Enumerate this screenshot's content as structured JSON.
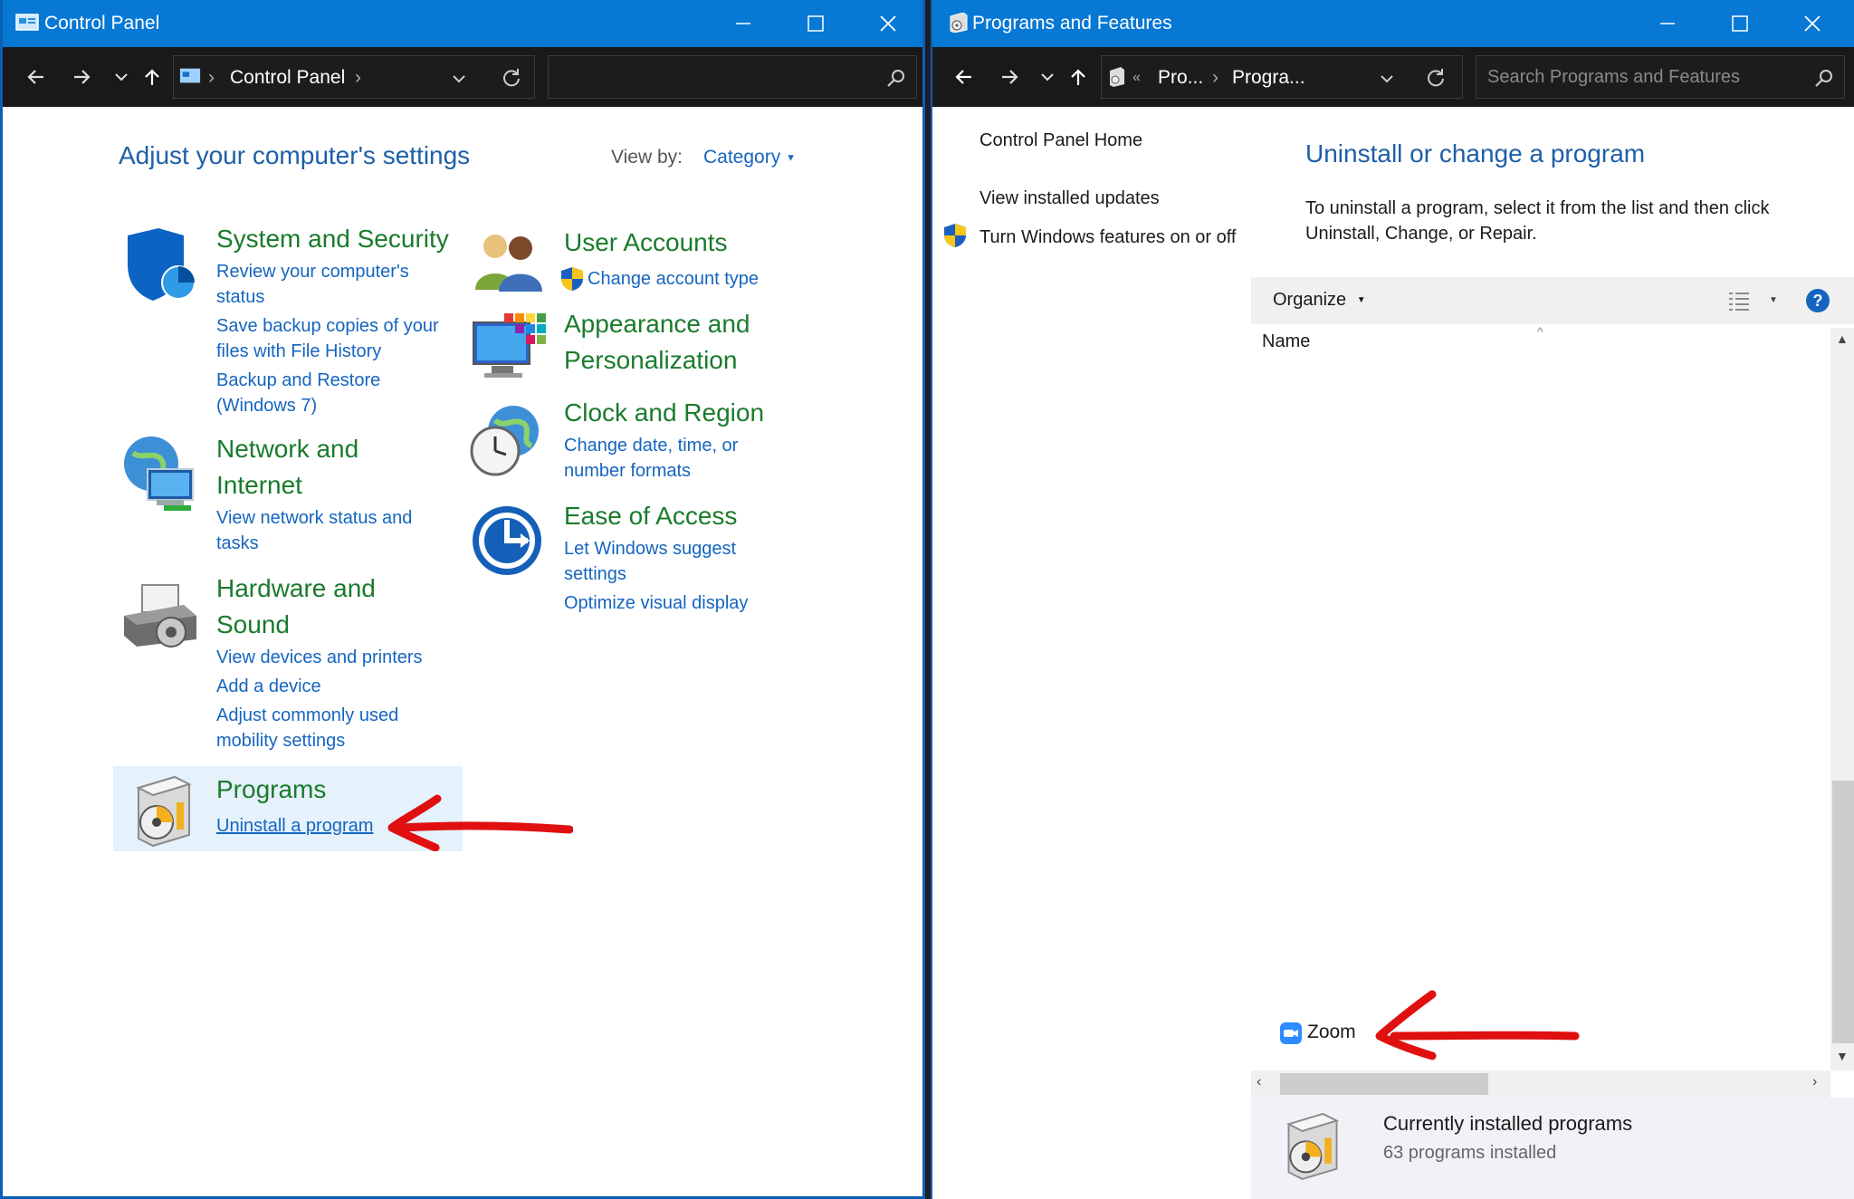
{
  "left_window": {
    "title": "Control Panel",
    "breadcrumb": "Control Panel",
    "heading": "Adjust your computer's settings",
    "view_by_label": "View by:",
    "view_by_value": "Category",
    "categories": [
      {
        "title": "System and Security",
        "links": [
          "Review your computer's status",
          "Save backup copies of your files with File History",
          "Backup and Restore (Windows 7)"
        ]
      },
      {
        "title": "Network and Internet",
        "links": [
          "View network status and tasks"
        ]
      },
      {
        "title": "Hardware and Sound",
        "links": [
          "View devices and printers",
          "Add a device",
          "Adjust commonly used mobility settings"
        ]
      },
      {
        "title": "Programs",
        "links": [
          "Uninstall a program"
        ]
      },
      {
        "title": "User Accounts",
        "links": [
          "Change account type"
        ]
      },
      {
        "title": "Appearance and Personalization",
        "links": []
      },
      {
        "title": "Clock and Region",
        "links": [
          "Change date, time, or number formats"
        ]
      },
      {
        "title": "Ease of Access",
        "links": [
          "Let Windows suggest settings",
          "Optimize visual display"
        ]
      }
    ]
  },
  "right_window": {
    "title": "Programs and Features",
    "breadcrumb": [
      "Pro...",
      "Progra..."
    ],
    "search_placeholder": "Search Programs and Features",
    "sidebar": {
      "home": "Control Panel Home",
      "updates": "View installed updates",
      "features": "Turn Windows features on or off"
    },
    "heading": "Uninstall or change a program",
    "description": "To uninstall a program, select it from the list and then click Uninstall, Change, or Repair.",
    "organize_label": "Organize",
    "column_name": "Name",
    "visible_program": "Zoom",
    "footer_title": "Currently installed programs",
    "footer_count": "63 programs installed"
  },
  "colors": {
    "titlebar": "#0778d4",
    "addressbar": "#191919",
    "category_green": "#1a7b2c",
    "link_blue": "#1565c0",
    "arrow_red": "#e01010",
    "selection": "#e5f1fb"
  }
}
